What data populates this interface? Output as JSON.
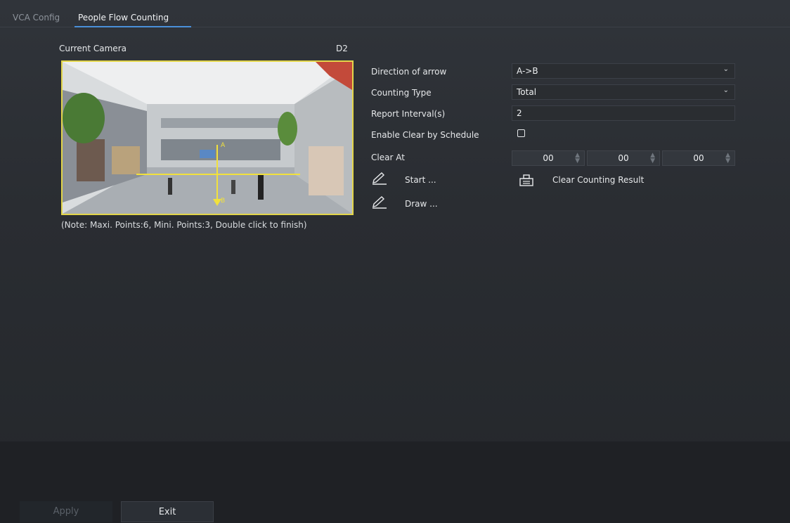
{
  "tabs": {
    "vca_config": "VCA Config",
    "people_flow": "People Flow Counting"
  },
  "camera": {
    "label": "Current Camera",
    "id": "D2"
  },
  "note": "(Note: Maxi. Points:6, Mini. Points:3, Double click to finish)",
  "form": {
    "direction_label": "Direction of arrow",
    "direction_value": "A->B",
    "counting_type_label": "Counting Type",
    "counting_type_value": "Total",
    "report_interval_label": "Report Interval(s)",
    "report_interval_value": "2",
    "enable_clear_label": "Enable Clear by Schedule",
    "enable_clear_checked": false,
    "clear_at_label": "Clear At",
    "clear_at": {
      "hour": "00",
      "minute": "00",
      "second": "00"
    }
  },
  "actions": {
    "start": "Start ...",
    "draw": "Draw ...",
    "clear_counting": "Clear Counting Result"
  },
  "footer": {
    "apply": "Apply",
    "exit": "Exit"
  },
  "colors": {
    "accent": "#4a90d9",
    "preview_border": "#e3d64a"
  }
}
